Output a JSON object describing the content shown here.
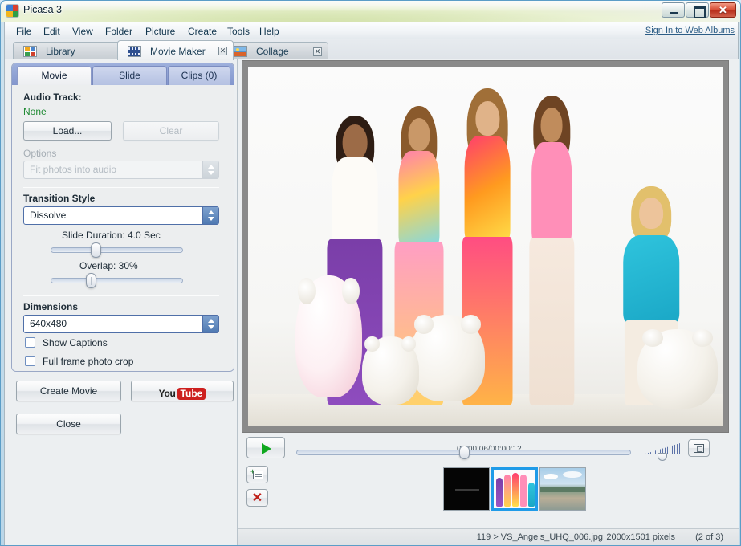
{
  "window": {
    "title": "Picasa 3",
    "app_icon": "picasa-icon",
    "controls": {
      "minimize": "–",
      "maximize": "□",
      "close": "✕"
    }
  },
  "menubar": {
    "items": [
      {
        "label": "File"
      },
      {
        "label": "Edit"
      },
      {
        "label": "View"
      },
      {
        "label": "Folder"
      },
      {
        "label": "Picture"
      },
      {
        "label": "Create"
      },
      {
        "label": "Tools"
      },
      {
        "label": "Help"
      }
    ],
    "signin_link": "Sign In to Web Albums"
  },
  "app_tabs": [
    {
      "label": "Library",
      "icon": "library-icon",
      "active": false,
      "closable": false
    },
    {
      "label": "Movie Maker",
      "icon": "film-icon",
      "active": true,
      "closable": true,
      "close_glyph": "✕"
    },
    {
      "label": "Collage",
      "icon": "photo-icon",
      "active": false,
      "closable": true,
      "close_glyph": "✕"
    }
  ],
  "settings_panel": {
    "tabs": [
      {
        "label": "Movie",
        "active": true
      },
      {
        "label": "Slide",
        "active": false
      },
      {
        "label": "Clips (0)",
        "active": false
      }
    ],
    "audio_track_label": "Audio Track:",
    "audio_track_value": "None",
    "load_button": "Load...",
    "clear_button": "Clear",
    "options_label": "Options",
    "options_value": "Fit photos into audio",
    "transition_label": "Transition Style",
    "transition_value": "Dissolve",
    "slide_duration_label": "Slide Duration: 4.0 Sec",
    "slide_duration_value": "4.0",
    "overlap_label": "Overlap: 30%",
    "overlap_value": "30",
    "dimensions_label": "Dimensions",
    "dimensions_value": "640x480",
    "show_captions_label": "Show Captions",
    "show_captions_checked": false,
    "full_frame_label": "Full frame photo crop",
    "full_frame_checked": false,
    "create_movie_button": "Create Movie",
    "youtube_button_you": "You",
    "youtube_button_tube": "Tube",
    "close_button": "Close"
  },
  "playback": {
    "play_icon": "play-icon",
    "timecode": "00:00:06/00:00:12",
    "position_percent": 50,
    "volume_icon": "volume-slider",
    "volume_percent": 42,
    "fullscreen_icon": "fullscreen-icon"
  },
  "clipbar": {
    "add_slide_icon": "add-slide-icon",
    "delete_icon": "delete-clip-icon",
    "thumbnails": [
      {
        "name": "title-slide-thumbnail",
        "kind": "black",
        "selected": false
      },
      {
        "name": "photo-thumbnail",
        "kind": "models",
        "selected": true
      },
      {
        "name": "landscape-thumbnail",
        "kind": "beach",
        "selected": false
      }
    ]
  },
  "statusbar": {
    "filename": "119 > VS_Angels_UHQ_006.jpg",
    "pixels": "2000x1501 pixels",
    "count": "(2 of 3)"
  },
  "colors": {
    "accent_blue": "#1f9be8",
    "panel_tab_blue": "#8396cd",
    "green_text": "#1f8a33",
    "play_green": "#0fa81e",
    "youtube_red": "#cd201f"
  }
}
